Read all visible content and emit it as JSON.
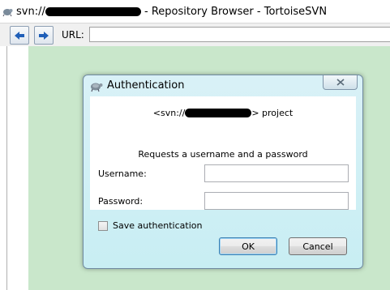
{
  "window": {
    "title_prefix": "svn://",
    "title_suffix": " - Repository Browser - TortoiseSVN"
  },
  "toolbar": {
    "back_icon": "back-arrow-icon",
    "forward_icon": "forward-arrow-icon",
    "url_label": "URL:",
    "url_value": ""
  },
  "dialog": {
    "title": "Authentication",
    "repo_prefix": "<svn://",
    "repo_suffix": "> project",
    "request_text": "Requests a username and a password",
    "username_label": "Username:",
    "username_value": "",
    "password_label": "Password:",
    "password_value": "",
    "save_auth_label": "Save authentication",
    "save_auth_checked": false,
    "ok_label": "OK",
    "cancel_label": "Cancel",
    "close_icon": "close-icon"
  },
  "colors": {
    "content_background": "#c9e7cb",
    "dialog_glass": "#c8eef3",
    "default_button_border": "#3c7fb1"
  }
}
